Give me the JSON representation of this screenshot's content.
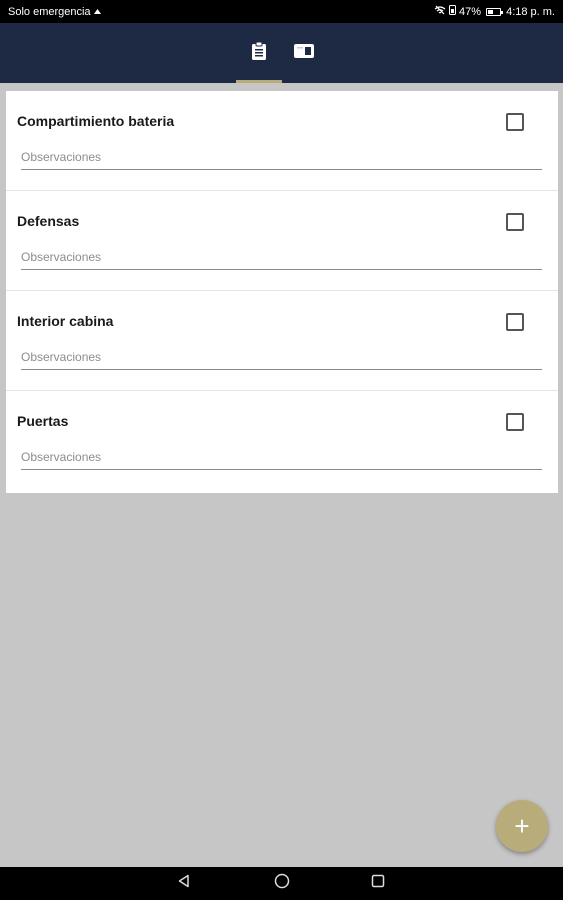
{
  "status_bar": {
    "left_text": "Solo emergencia",
    "battery_percent": "47%",
    "battery_level": 0.47,
    "time": "4:18 p. m."
  },
  "app_bar": {
    "tabs": [
      {
        "icon": "clipboard-icon",
        "selected": true
      },
      {
        "icon": "card-icon",
        "selected": false
      }
    ],
    "accent_color": "#b8ad7a",
    "background_color": "#1e2a44"
  },
  "checklist": {
    "items": [
      {
        "title": "Compartimiento bateria",
        "checked": false,
        "observations_placeholder": "Observaciones",
        "observations_value": ""
      },
      {
        "title": "Defensas",
        "checked": false,
        "observations_placeholder": "Observaciones",
        "observations_value": ""
      },
      {
        "title": "Interior cabina",
        "checked": false,
        "observations_placeholder": "Observaciones",
        "observations_value": ""
      },
      {
        "title": "Puertas",
        "checked": false,
        "observations_placeholder": "Observaciones",
        "observations_value": ""
      }
    ]
  },
  "fab": {
    "icon": "plus-icon",
    "label": "+"
  },
  "nav_bar": {
    "buttons": [
      "back-icon",
      "home-icon",
      "recent-apps-icon"
    ]
  }
}
